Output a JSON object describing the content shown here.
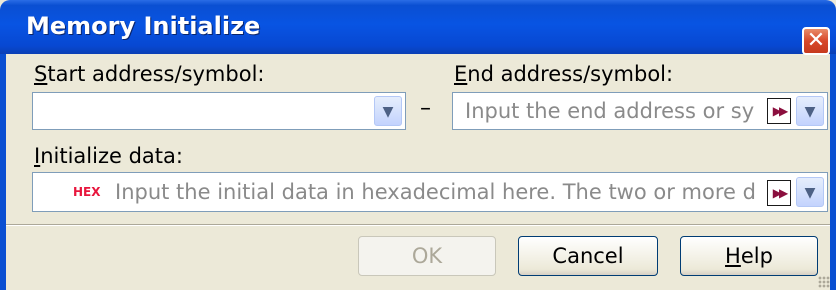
{
  "window": {
    "title": "Memory Initialize",
    "close_label": "✕"
  },
  "start": {
    "label_accel": "S",
    "label_rest": "tart address/symbol:",
    "value": ""
  },
  "end": {
    "label_accel": "E",
    "label_rest": "nd address/symbol:",
    "placeholder": "Input the end address or sy"
  },
  "init": {
    "label_accel": "I",
    "label_rest": "nitialize data:",
    "hex_tag": "HEX",
    "placeholder": "Input the initial data in hexadecimal here. The two or more data"
  },
  "range_separator": "–",
  "buttons": {
    "ok": "OK",
    "cancel": "Cancel",
    "help_accel": "H",
    "help_rest": "elp"
  },
  "icons": {
    "dropdown": "chevron-down-icon",
    "expand": "fast-forward-icon",
    "close": "close-icon",
    "grip": "resize-grip-icon"
  }
}
